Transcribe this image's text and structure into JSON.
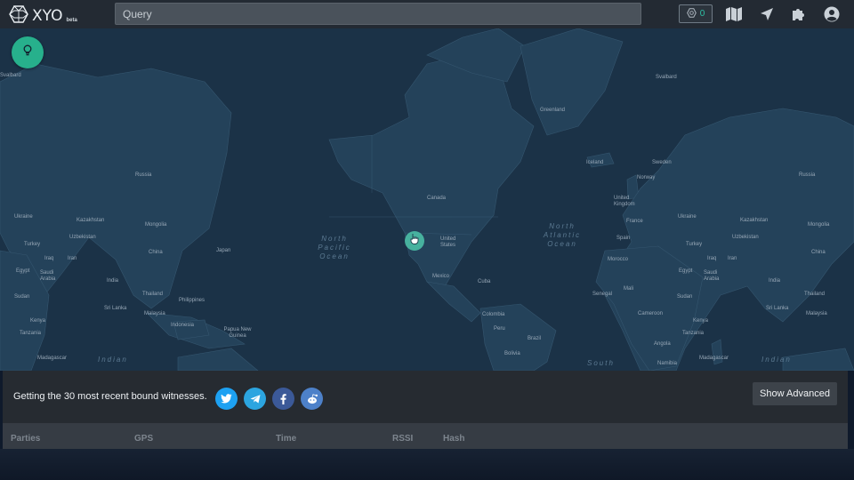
{
  "app": {
    "logo_text": "XYO",
    "logo_badge": "beta",
    "logo_icon": "hexagon-logo-icon"
  },
  "search": {
    "placeholder": "Query",
    "value": ""
  },
  "topbar": {
    "badge_count": "0",
    "badge_icon": "network-icon",
    "icons": [
      "map-icon",
      "location-arrow-icon",
      "puzzle-icon",
      "user-account-icon"
    ]
  },
  "map": {
    "ocean_color": "#1b3247",
    "land_color": "#24425a",
    "accent": "#27b08c",
    "labels": [
      "Svalbard",
      "Svalbard",
      "Greenland",
      "Iceland",
      "Sweden",
      "Norway",
      "Russia",
      "Russia",
      "Canada",
      "United Kingdom",
      "France",
      "Ukraine",
      "Ukraine",
      "Kazakhstan",
      "Kazakhstan",
      "Mongolia",
      "Mongolia",
      "Uzbekistan",
      "Uzbekistan",
      "Turkey",
      "Turkey",
      "Spain",
      "United States",
      "Iraq",
      "Iran",
      "Iraq",
      "Iran",
      "China",
      "China",
      "Japan",
      "Morocco",
      "Egypt",
      "Egypt",
      "Saudi Arabia",
      "Saudi Arabia",
      "India",
      "India",
      "Mexico",
      "Cuba",
      "Thailand",
      "Thailand",
      "Philippines",
      "Mali",
      "Sudan",
      "Sudan",
      "Sri Lanka",
      "Sri Lanka",
      "Malaysia",
      "Malaysia",
      "Senegal",
      "Colombia",
      "Cameroon",
      "Kenya",
      "Kenya",
      "Indonesia",
      "Peru",
      "Brazil",
      "Tanzania",
      "Tanzania",
      "Papua New Guinea",
      "Angola",
      "Bolivia",
      "Madagascar",
      "Madagascar",
      "Namibia"
    ],
    "oceans": [
      "North Pacific Ocean",
      "North Atlantic Ocean",
      "Indian",
      "Indian",
      "South"
    ]
  },
  "panel": {
    "status_text": "Getting the 30 most recent bound witnesses.",
    "share_icons": [
      "twitter-icon",
      "telegram-icon",
      "facebook-icon",
      "reddit-icon"
    ],
    "share_colors": [
      "#1da1f2",
      "#2ca5e0",
      "#3b5998",
      "#4d81c9"
    ],
    "show_advanced": "Show Advanced"
  },
  "table": {
    "columns": [
      "Parties",
      "GPS",
      "Time",
      "RSSI",
      "Hash"
    ]
  }
}
